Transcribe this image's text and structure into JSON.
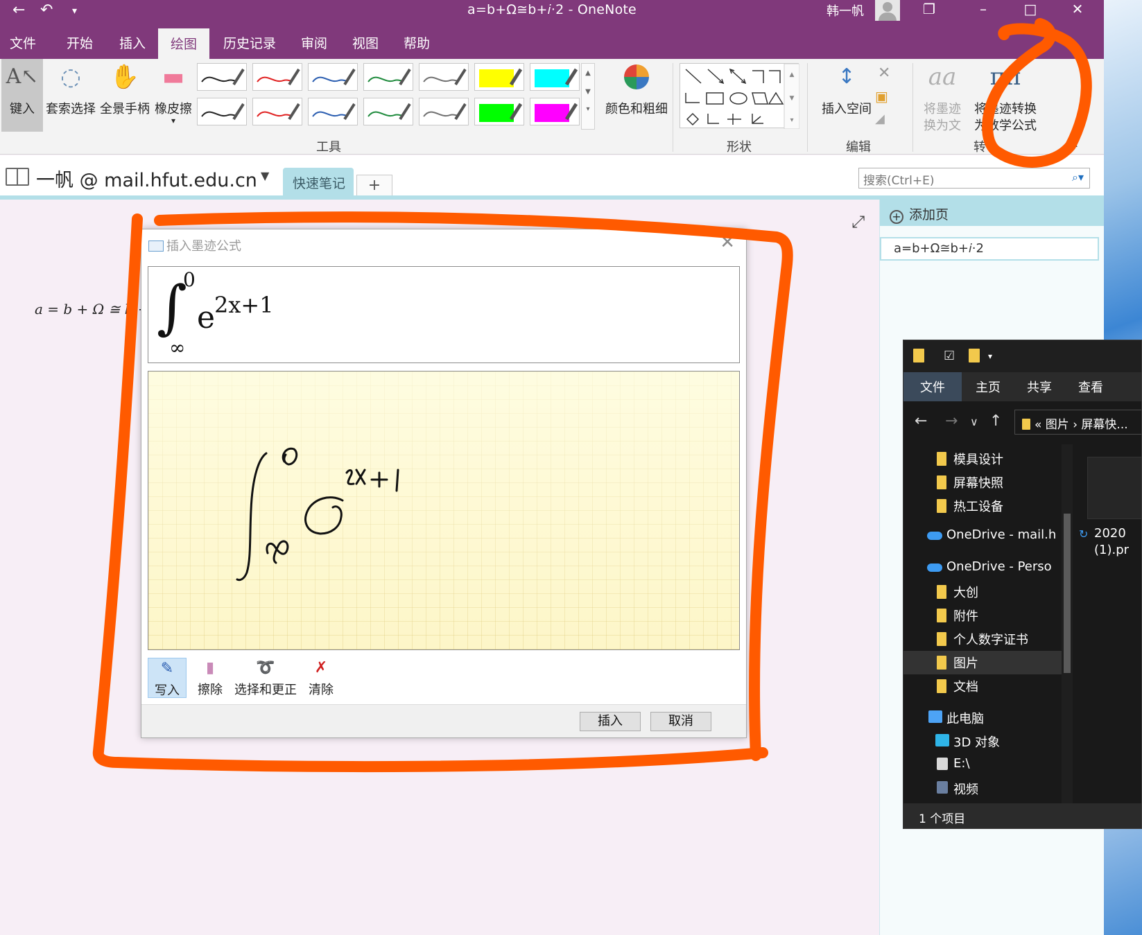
{
  "window": {
    "title": "a=b+Ω≅b+𝑖·2  -  OneNote",
    "user": "韩一帆"
  },
  "ribbon_tabs": [
    "文件",
    "开始",
    "插入",
    "绘图",
    "历史记录",
    "审阅",
    "视图",
    "帮助"
  ],
  "active_tab": "绘图",
  "ribbon": {
    "type_label": "键入",
    "lasso_label": "套索选择",
    "pan_label": "全景手柄",
    "eraser_label": "橡皮擦",
    "color_label": "颜色和粗细",
    "tools_group": "工具",
    "shapes_group": "形状",
    "insert_space_label": "插入空间",
    "edit_group": "编辑",
    "ink_to_text_line1": "将墨迹",
    "ink_to_text_line2": "换为文",
    "ink_to_math_line1": "将墨迹转换",
    "ink_to_math_line2": "为数学公式",
    "convert_group": "转"
  },
  "pen_colors": [
    "#222222",
    "#e02020",
    "#2a5db0",
    "#1e8a3c",
    "#707070",
    "#ffff00",
    "#00ffff",
    "#222222",
    "#e02020",
    "#2a5db0",
    "#1e8a3c",
    "#707070",
    "#00ff00",
    "#ff00ff"
  ],
  "notebook": {
    "name": "一帆 @ mail.hfut.edu.cn",
    "section": "快速笔记",
    "add_section": "+",
    "search_placeholder": "搜索(Ctrl+E)"
  },
  "page": {
    "equation_fragment": "a = b + Ω ≅ b +"
  },
  "pages_pane": {
    "add_page": "添加页",
    "items": [
      "a=b+Ω≅b+𝑖·2"
    ]
  },
  "dialog": {
    "title": "插入墨迹公式",
    "preview": {
      "integral": "∫",
      "upper": "0",
      "lower": "∞",
      "base": "e",
      "exponent": "2x+1"
    },
    "tools": [
      "写入",
      "擦除",
      "选择和更正",
      "清除"
    ],
    "insert_label": "插入",
    "cancel_label": "取消"
  },
  "explorer": {
    "tabs": [
      "文件",
      "主页",
      "共享",
      "查看"
    ],
    "breadcrumb": "« 图片 › 屏幕快...",
    "tree": [
      "模具设计",
      "屏幕快照",
      "热工设备",
      "OneDrive - mail.h",
      "OneDrive - Perso",
      "大创",
      "附件",
      "个人数字证书",
      "图片",
      "文档",
      "此电脑",
      "3D 对象",
      "E:\\",
      "视频"
    ],
    "selected": "图片",
    "file_label_line1": "2020",
    "file_label_line2": "(1).pr",
    "status": "1 个项目"
  },
  "annotation_color": "#ff5a00"
}
